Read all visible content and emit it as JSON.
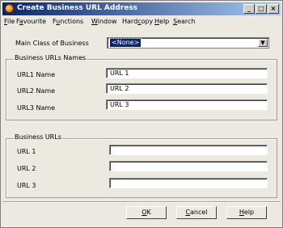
{
  "window": {
    "title": "Create Business URL Address",
    "minimize_glyph": "_",
    "maximize_glyph": "□",
    "close_glyph": "×"
  },
  "menu": [
    {
      "first": "F",
      "rest": "ile"
    },
    {
      "pre": "F",
      "u": "a",
      "post": "vourite"
    },
    {
      "pre": "F",
      "u": "u",
      "post": "nctions"
    },
    {
      "first": "W",
      "rest": "indow"
    },
    {
      "pre": "Hard",
      "u": "c",
      "post": "opy"
    },
    {
      "first": "H",
      "rest": "elp"
    },
    {
      "first": "S",
      "rest": "earch"
    }
  ],
  "main_class": {
    "label": "Main Class of Business",
    "value": "<None>",
    "arrow_glyph": "▼"
  },
  "names_group": {
    "title": "Business URLs Names",
    "rows": [
      {
        "label": "URL1 Name",
        "value": "URL 1"
      },
      {
        "label": "URL2 Name",
        "value": "URL 2"
      },
      {
        "label": "URL3 Name",
        "value": "URL 3"
      }
    ]
  },
  "urls_group": {
    "title": "Business URLs",
    "rows": [
      {
        "label": "URL 1",
        "value": ""
      },
      {
        "label": "URL 2",
        "value": ""
      },
      {
        "label": "URL 3",
        "value": ""
      }
    ]
  },
  "buttons": {
    "ok": {
      "u": "O",
      "rest": "K"
    },
    "cancel": {
      "u": "C",
      "rest": "ancel"
    },
    "help": {
      "u": "H",
      "rest": "elp"
    }
  }
}
